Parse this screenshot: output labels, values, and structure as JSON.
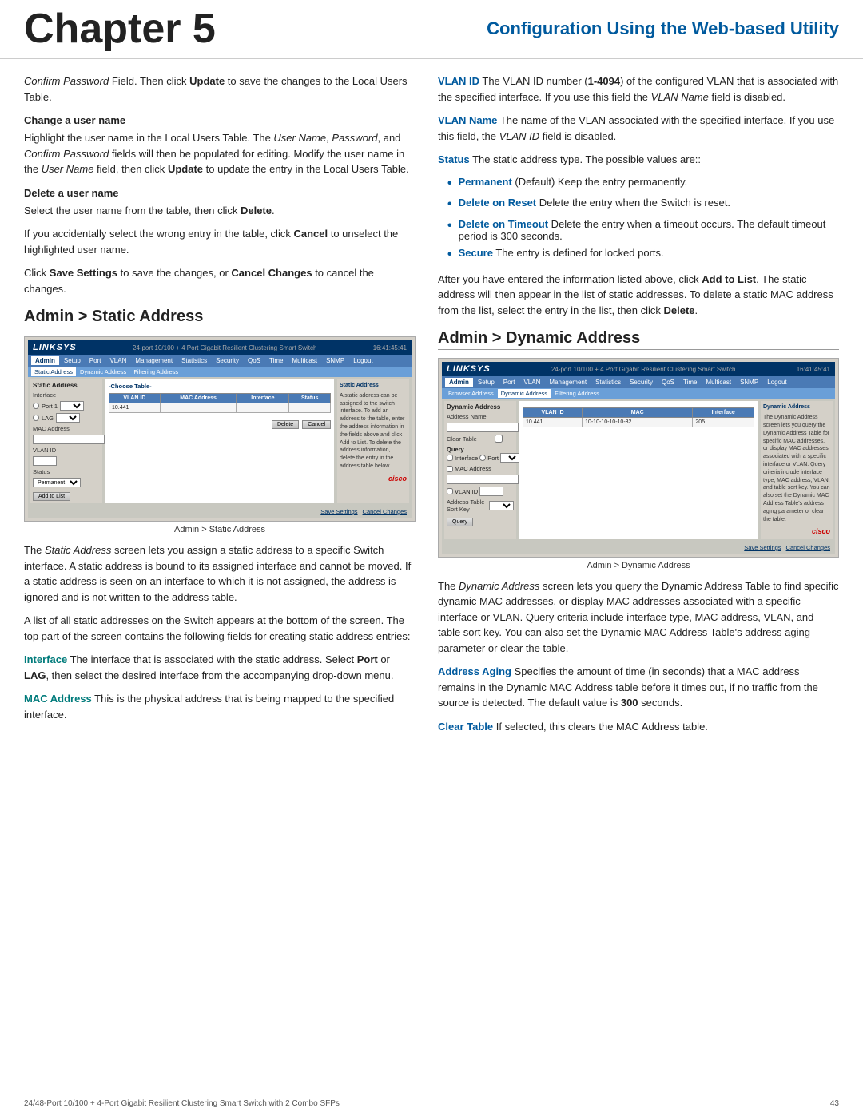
{
  "header": {
    "chapter": "Chapter 5",
    "subtitle": "Configuration Using the Web-based Utility"
  },
  "left_col": {
    "intro_para": "Confirm Password Field. Then click Update to save the changes to the Local Users Table.",
    "change_heading": "Change a user name",
    "change_para": "Highlight the user name in the Local Users Table. The User Name, Password, and Confirm Password fields will then be populated for editing. Modify the user name in the User Name field, then click Update to update the entry in the Local Users Table.",
    "delete_heading": "Delete a user name",
    "delete_para1": "Select the user name from the table, then click Delete.",
    "delete_para2": "If you accidentally select the wrong entry in the table, click Cancel to unselect the highlighted user name.",
    "delete_para3": "Click Save Settings to save the changes, or Cancel Changes to cancel the changes.",
    "admin_static_title": "Admin > Static Address",
    "screenshot1_caption": "Admin > Static Address",
    "static_desc1": "The Static Address screen lets you assign a static address to a specific Switch interface. A static address is bound to its assigned interface and cannot be moved. If a static address is seen on an interface to which it is not assigned, the address is ignored and is not written to the address table.",
    "static_desc2": "A list of all static addresses on the Switch appears at the bottom of the screen. The top part of the screen contains the following fields for creating static address entries:",
    "interface_label": "Interface",
    "interface_desc": "The interface that is associated with the static address. Select Port or LAG, then select the desired interface from the accompanying drop-down menu.",
    "mac_label": "MAC Address",
    "mac_desc": "This is the physical address that is being mapped to the specified interface."
  },
  "right_col": {
    "vlan_id_label": "VLAN ID",
    "vlan_id_desc": "The VLAN ID number (1-4094) of the configured VLAN that is associated with the specified interface. If you use this field the VLAN Name field is disabled.",
    "vlan_name_label": "VLAN Name",
    "vlan_name_desc": "The name of the VLAN associated with the specified interface. If you use this field, the VLAN ID field is disabled.",
    "status_label": "Status",
    "status_desc": "The static address type. The possible values are::",
    "bullets": [
      {
        "term": "Permanent",
        "desc": "(Default) Keep the entry permanently."
      },
      {
        "term": "Delete on Reset",
        "desc": "Delete the entry when the Switch is reset."
      },
      {
        "term": "Delete on Timeout",
        "desc": "Delete the entry when a timeout occurs. The default timeout period is 300 seconds."
      },
      {
        "term": "Secure",
        "desc": "The entry is defined for locked ports."
      }
    ],
    "after_para": "After you have entered the information listed above, click Add to List. The static address will then appear in the list of static addresses. To delete a static MAC address from the list, select the entry in the list, then click Delete.",
    "admin_dynamic_title": "Admin > Dynamic Address",
    "screenshot2_caption": "Admin > Dynamic Address",
    "dynamic_desc1": "The Dynamic Address screen lets you query the Dynamic Address Table to find specific dynamic MAC addresses, or display MAC addresses associated with a specific interface or VLAN. Query criteria include interface type, MAC address, VLAN, and table sort key. You can also set the Dynamic MAC Address Table's address aging parameter or clear the table.",
    "address_aging_label": "Address Aging",
    "address_aging_desc": "Specifies the amount of time (in seconds) that a MAC address remains in the Dynamic MAC Address table before it times out, if no traffic from the source is detected. The default value is 300 seconds.",
    "clear_table_label": "Clear Table",
    "clear_table_desc": "If selected, this clears the MAC Address table."
  },
  "footer": {
    "left": "24/48-Port 10/100 + 4-Port Gigabit Resilient Clustering Smart Switch with 2 Combo SFPs",
    "right": "43"
  },
  "linksys_nav": [
    "Setup",
    "Port",
    "VLAN",
    "Management",
    "Statistics",
    "Security",
    "QoS",
    "Time",
    "Multicast",
    "SNMP",
    "Logout"
  ],
  "linksys_subnav": [
    "Static Address",
    "Dynamic Address",
    "Filtering Address"
  ],
  "linksys_nav2": [
    "Admin",
    "Setup",
    "Port",
    "VLAN",
    "Management",
    "Statistics",
    "Security",
    "QoS",
    "Time",
    "Multicast",
    "SNMP",
    "Logout"
  ],
  "linksys_subnav2": [
    "Browser Address",
    "Dynamic Address",
    "Filtering Address"
  ],
  "table_headers_static": [
    "VLAN ID",
    "MAC Address",
    "Interface",
    "Status"
  ],
  "table_headers_dynamic": [
    "VLAN ID",
    "MAC",
    "Interface"
  ]
}
